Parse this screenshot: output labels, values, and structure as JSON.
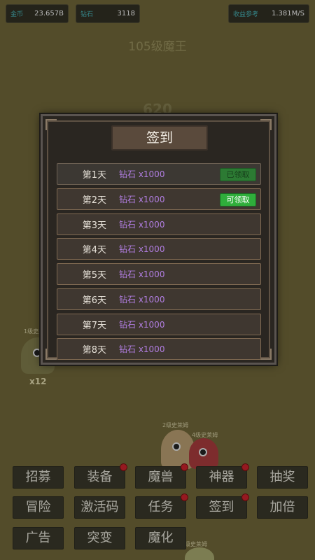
{
  "stats": {
    "gold": {
      "label": "金币",
      "value": "23.657B"
    },
    "diamond": {
      "label": "钻石",
      "value": "3118"
    },
    "income": {
      "label": "收益参考",
      "value": "1.381M/S"
    }
  },
  "boss": {
    "title": "105级魔王",
    "hp": "620"
  },
  "monsters": [
    {
      "tag": "1级史莱",
      "count": "x12"
    },
    {
      "tag": "2级史莱姆",
      "count": ""
    },
    {
      "tag": "4级史莱姆",
      "count": ""
    },
    {
      "tag": "级史莱姆",
      "count": ""
    }
  ],
  "dialog": {
    "title": "签到",
    "rows": [
      {
        "day": "第1天",
        "reward": "钻石 x1000",
        "button": "已领取"
      },
      {
        "day": "第2天",
        "reward": "钻石 x1000",
        "button": "可领取"
      },
      {
        "day": "第3天",
        "reward": "钻石 x1000",
        "button": ""
      },
      {
        "day": "第4天",
        "reward": "钻石 x1000",
        "button": ""
      },
      {
        "day": "第5天",
        "reward": "钻石 x1000",
        "button": ""
      },
      {
        "day": "第6天",
        "reward": "钻石 x1000",
        "button": ""
      },
      {
        "day": "第7天",
        "reward": "钻石 x1000",
        "button": ""
      },
      {
        "day": "第8天",
        "reward": "钻石 x1000",
        "button": ""
      }
    ]
  },
  "menu": {
    "recruit": "招募",
    "equip": "装备",
    "beast": "魔兽",
    "artifact": "神器",
    "lottery": "抽奖",
    "adventure": "冒险",
    "code": "激活码",
    "task": "任务",
    "signin": "签到",
    "multiplier": "加倍",
    "ads": "广告",
    "mutate": "突变",
    "demonize": "魔化"
  },
  "colors": {
    "background": "#6b6236",
    "claim_active": "#2fae3b",
    "reward_text": "#b07de0",
    "notification_dot": "#c0202a"
  }
}
